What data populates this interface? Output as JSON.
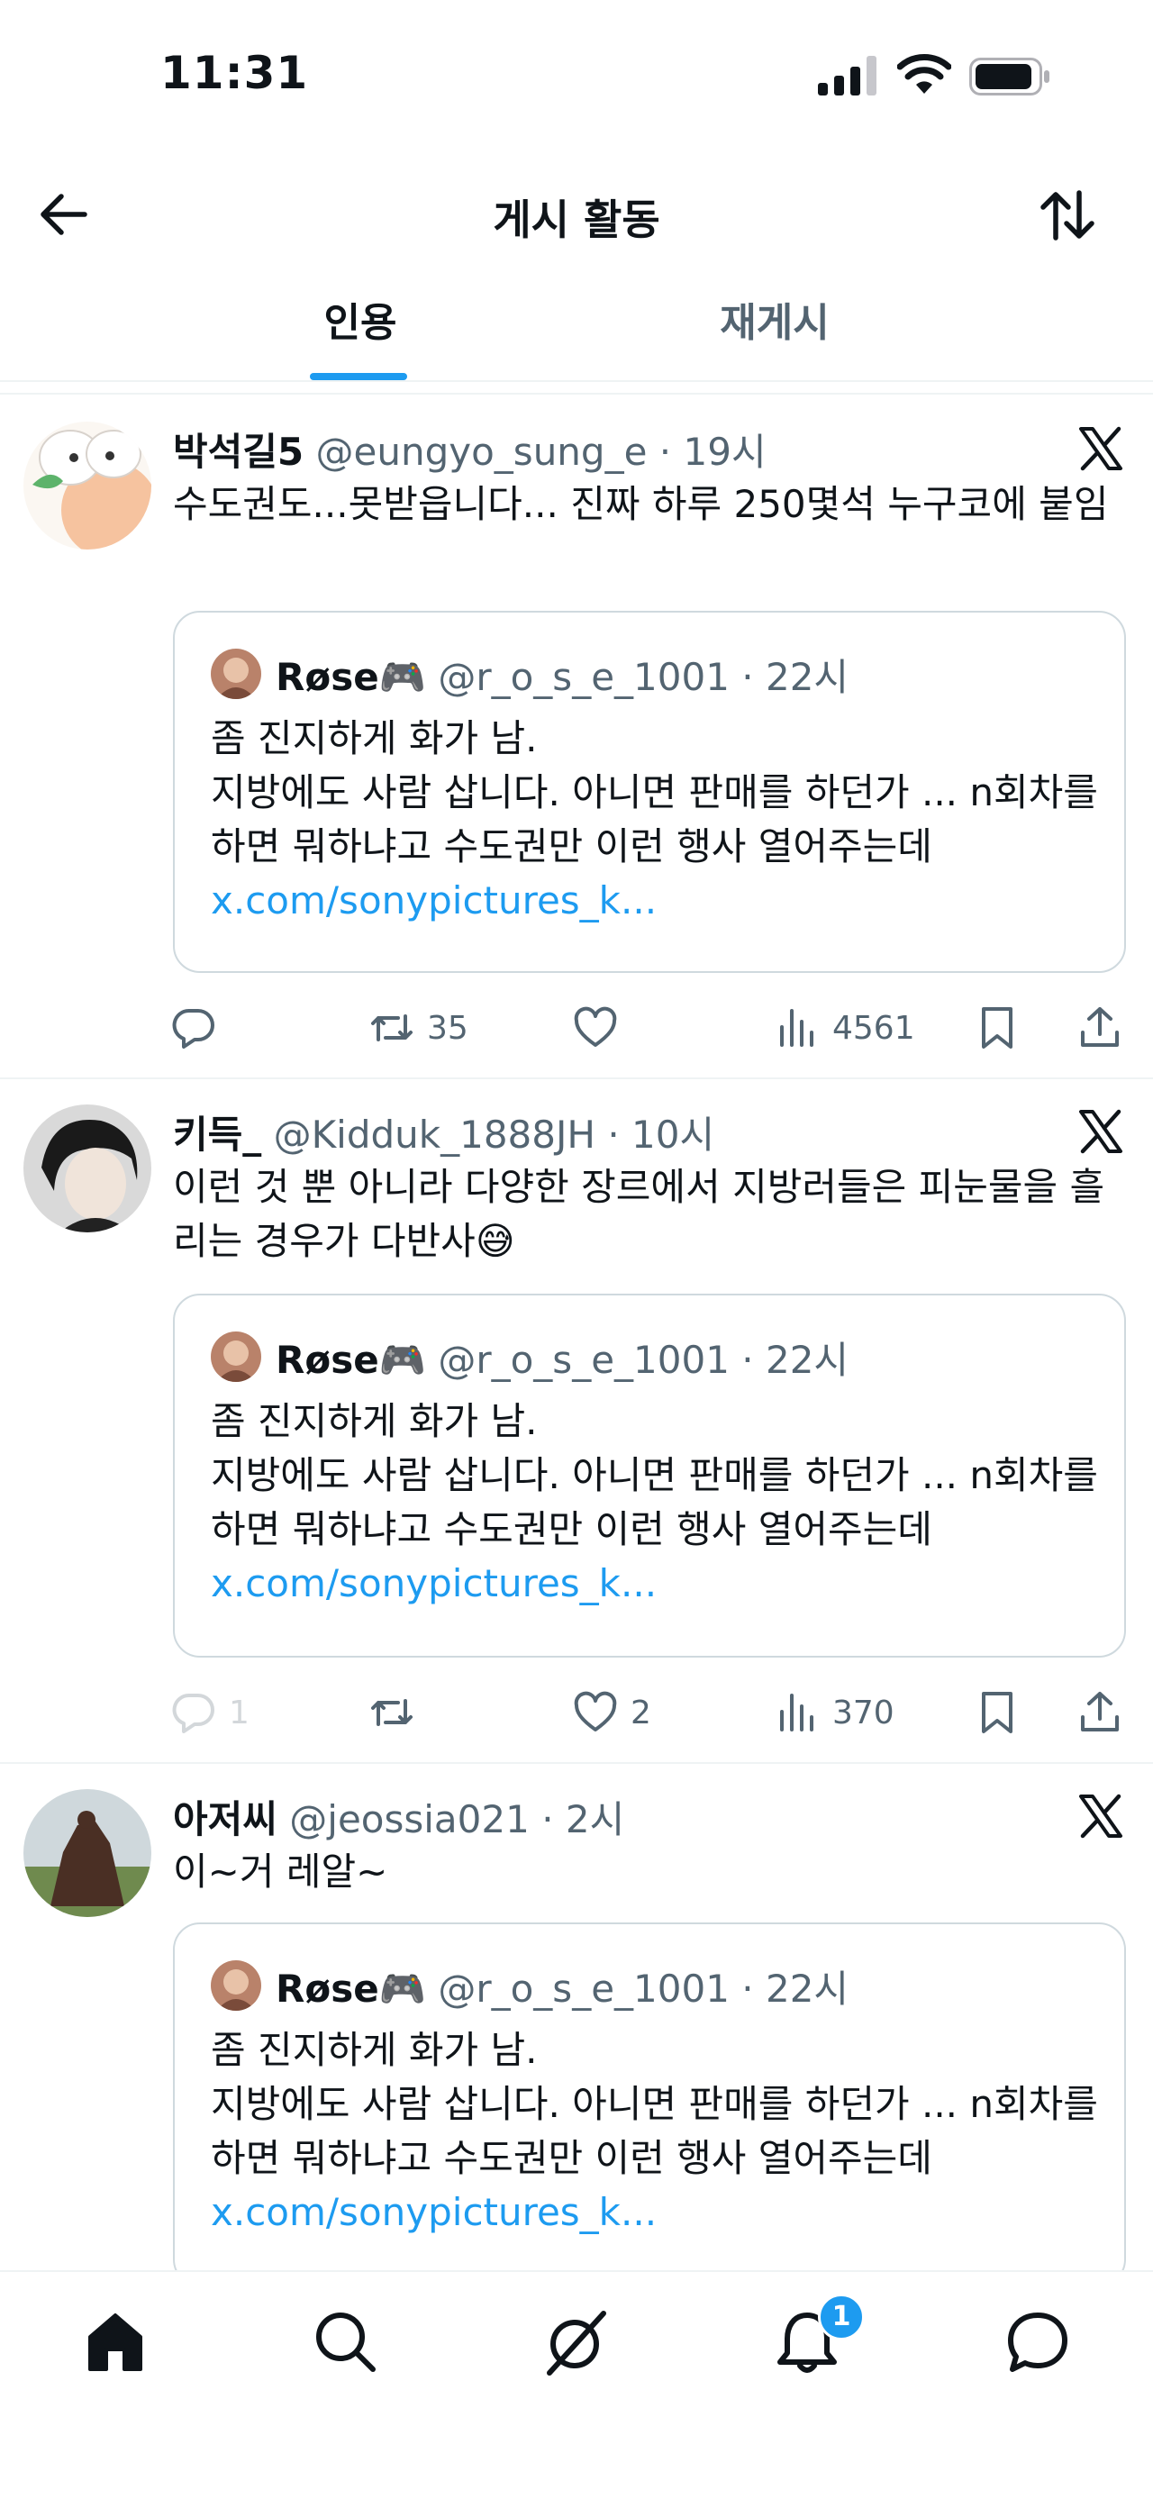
{
  "status_bar": {
    "time": "11:31"
  },
  "header": {
    "title": "게시 활동",
    "tabs": [
      {
        "label": "인용",
        "active": true
      },
      {
        "label": "재게시",
        "active": false
      }
    ]
  },
  "colors": {
    "accent": "#1d9bf0",
    "muted": "#536471",
    "text": "#0f1419",
    "border": "#cfd9de"
  },
  "posts": [
    {
      "name": "박석길5",
      "handle": "@eungyo_sung_e",
      "time": "· 19시",
      "text": "수도권도...못받읍니다... 진짜 하루 250몇석 누구코에 붙임",
      "quote": {
        "name": "Røse🎮",
        "handle": "@r_o_s_e_1001",
        "time": "· 22시",
        "text": "좀 진지하게 화가 남.\n지방에도 사람 삽니다. 아니면 판매를 하던가 ... n회차를 하면 뭐하냐고 수도권만 이런 행사 열어주는데",
        "link": "x.com/sonypictures_k..."
      },
      "stats": {
        "replies": "",
        "reposts": "35",
        "likes": "",
        "views": "4561"
      }
    },
    {
      "name": "키득_",
      "handle": "@Kidduk_1888JH",
      "time": "· 10시",
      "text": "이런 것 뿐 아니라 다양한 장르에서 지방러들은 피눈물을 흘리는 경우가 다반사😅",
      "quote": {
        "name": "Røse🎮",
        "handle": "@r_o_s_e_1001",
        "time": "· 22시",
        "text": "좀 진지하게 화가 남.\n지방에도 사람 삽니다. 아니면 판매를 하던가 ... n회차를 하면 뭐하냐고 수도권만 이런 행사 열어주는데",
        "link": "x.com/sonypictures_k..."
      },
      "stats": {
        "replies": "1",
        "reposts": "",
        "likes": "2",
        "views": "370"
      }
    },
    {
      "name": "아저씨",
      "handle": "@jeossia021",
      "time": "· 2시",
      "text": "이~거 레알~",
      "quote": {
        "name": "Røse🎮",
        "handle": "@r_o_s_e_1001",
        "time": "· 22시",
        "text": "좀 진지하게 화가 남.\n지방에도 사람 삽니다. 아니면 판매를 하던가 ... n회차를 하면 뭐하냐고 수도권만 이런 행사 열어주는데",
        "link": "x.com/sonypictures_k..."
      }
    }
  ],
  "bottom_nav": {
    "items": [
      "home-icon",
      "search-icon",
      "grok-icon",
      "bell-icon",
      "messages-icon"
    ],
    "notification_badge": "1"
  }
}
